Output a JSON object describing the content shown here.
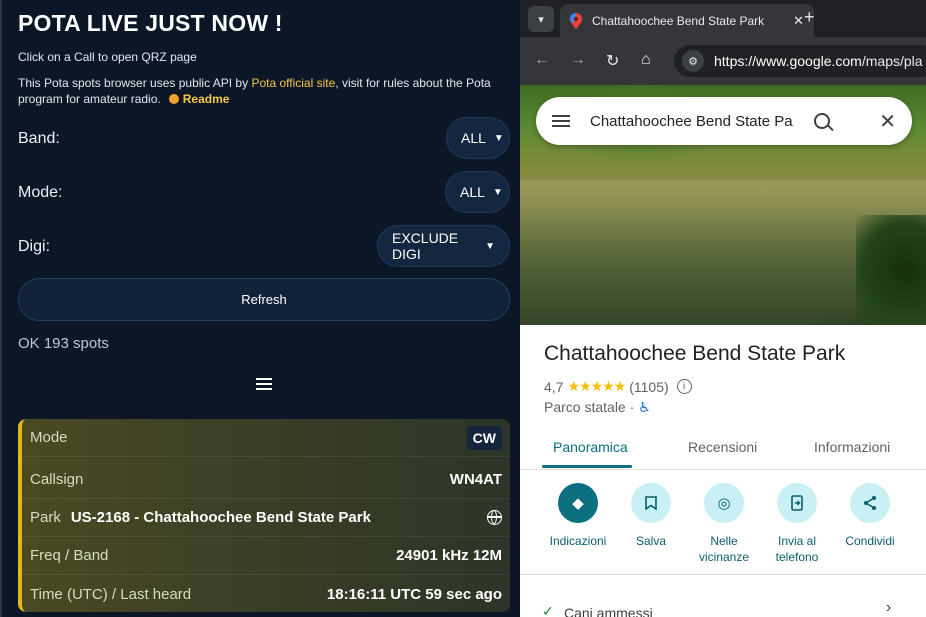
{
  "pota": {
    "title": "POTA LIVE JUST NOW !",
    "subtitle": "Click on a Call to open QRZ page",
    "info_prefix": "This Pota spots browser uses public API by ",
    "info_link": "Pota official site",
    "info_suffix": ", visit for rules about the Pota program for amateur radio.",
    "readme": "Readme",
    "band_label": "Band:",
    "band_value": "ALL",
    "mode_label": "Mode:",
    "mode_value": "ALL",
    "digi_label": "Digi:",
    "digi_value": "EXCLUDE DIGI",
    "refresh_label": "Refresh",
    "status": "OK 193 spots",
    "spot": {
      "mode_key": "Mode",
      "mode_val": "CW",
      "callsign_key": "Callsign",
      "callsign_val": "WN4AT",
      "park_key": "Park",
      "park_val": "US-2168 - Chattahoochee Bend State Park",
      "freq_key": "Freq / Band",
      "freq_val": "24901 kHz 12M",
      "time_key": "Time (UTC) / Last heard",
      "time_val": "18:16:11 UTC 59 sec ago"
    },
    "accent": "#e0b81c"
  },
  "browser": {
    "tab_title": "Chattahoochee Bend State Park",
    "tab_close": "✕",
    "new_tab": "+",
    "url_host": "https://www.google.com",
    "url_path": "/maps/pla"
  },
  "maps": {
    "search_query": "Chattahoochee Bend State Pa",
    "place_title": "Chattahoochee Bend State Park",
    "rating_value": "4,7",
    "rating_stars": "★★★★★",
    "rating_count": "(1105)",
    "place_type": "Parco statale ·",
    "tabs": [
      "Panoramica",
      "Recensioni",
      "Informazioni"
    ],
    "actions": [
      {
        "label": "Indicazioni",
        "icon": "directions-icon"
      },
      {
        "label": "Salva",
        "icon": "bookmark-icon"
      },
      {
        "label": "Nelle vicinanze",
        "icon": "nearby-icon"
      },
      {
        "label": "Invia al telefono",
        "icon": "send-to-phone-icon"
      },
      {
        "label": "Condividi",
        "icon": "share-icon"
      }
    ],
    "amenity": "Cani ammessi",
    "accent": "#0b6f80"
  }
}
